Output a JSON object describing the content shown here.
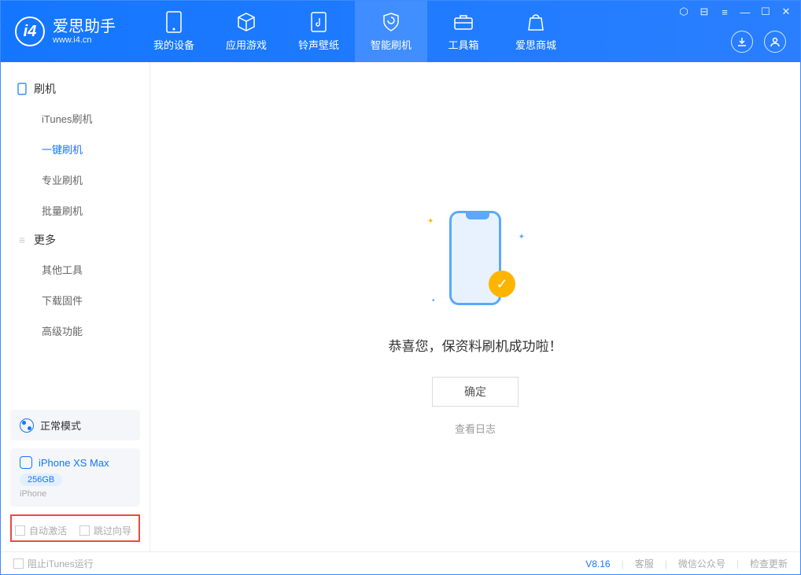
{
  "app": {
    "title": "爱思助手",
    "subtitle": "www.i4.cn"
  },
  "nav": {
    "items": [
      {
        "label": "我的设备"
      },
      {
        "label": "应用游戏"
      },
      {
        "label": "铃声壁纸"
      },
      {
        "label": "智能刷机"
      },
      {
        "label": "工具箱"
      },
      {
        "label": "爱思商城"
      }
    ]
  },
  "sidebar": {
    "section1": {
      "title": "刷机",
      "items": [
        "iTunes刷机",
        "一键刷机",
        "专业刷机",
        "批量刷机"
      ]
    },
    "section2": {
      "title": "更多",
      "items": [
        "其他工具",
        "下载固件",
        "高级功能"
      ]
    },
    "mode": "正常模式",
    "device": {
      "name": "iPhone XS Max",
      "capacity": "256GB",
      "type": "iPhone"
    },
    "checks": {
      "c1": "自动激活",
      "c2": "跳过向导"
    }
  },
  "main": {
    "success": "恭喜您，保资料刷机成功啦！",
    "ok": "确定",
    "log": "查看日志"
  },
  "footer": {
    "block_itunes": "阻止iTunes运行",
    "version": "V8.16",
    "links": [
      "客服",
      "微信公众号",
      "检查更新"
    ]
  }
}
